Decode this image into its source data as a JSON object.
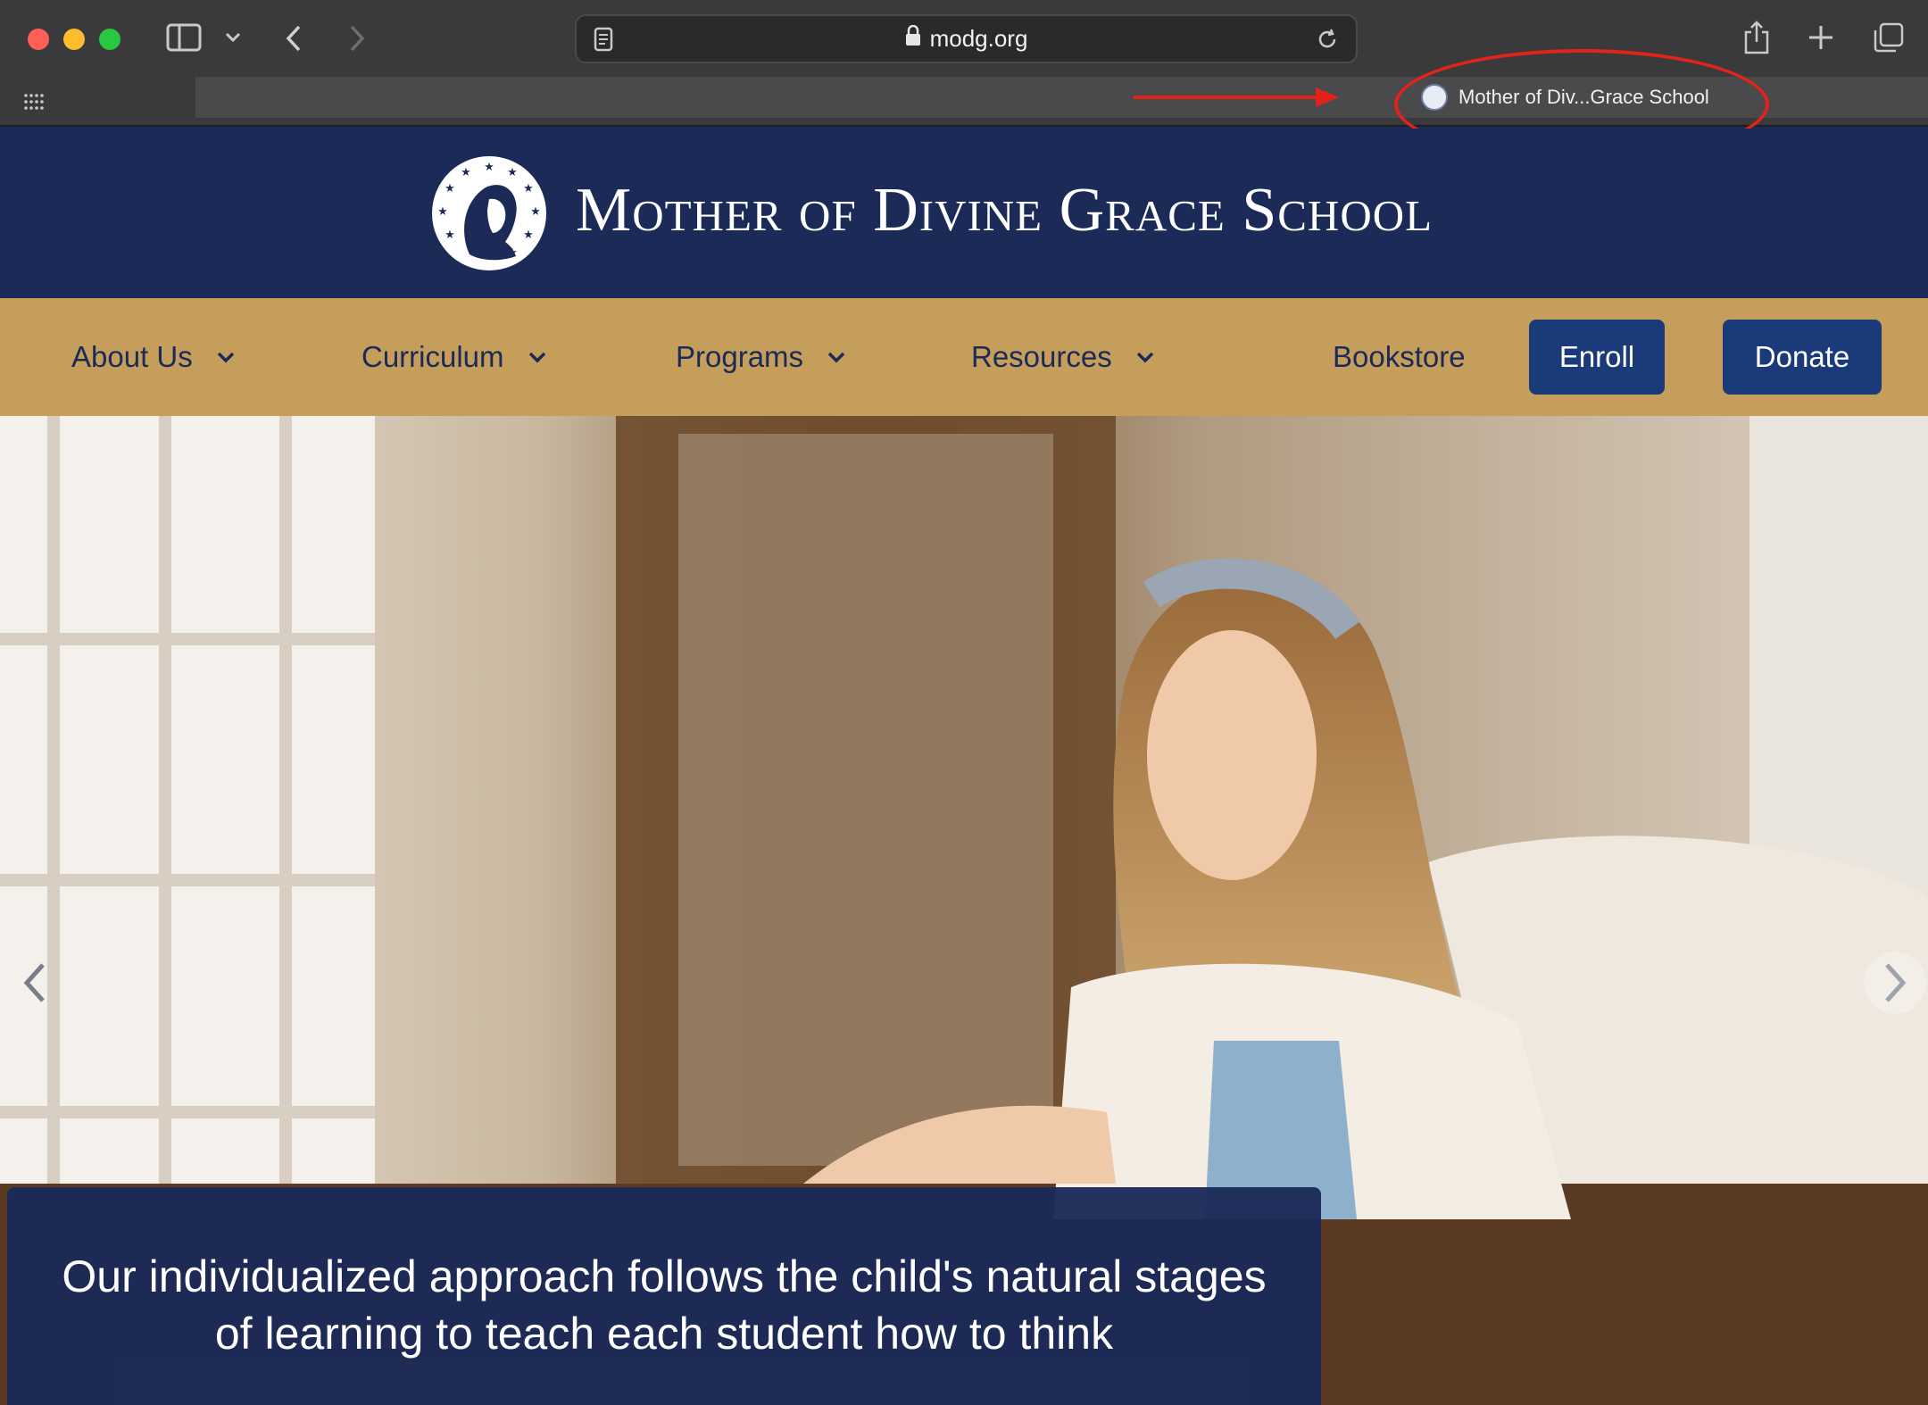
{
  "browser": {
    "url": "modg.org",
    "tab_title": "Mother of Div...Grace School"
  },
  "site": {
    "title": "Mother of Divine Grace School"
  },
  "nav": {
    "items": [
      {
        "label": "About Us"
      },
      {
        "label": "Curriculum"
      },
      {
        "label": "Programs"
      },
      {
        "label": "Resources"
      },
      {
        "label": "Bookstore"
      }
    ],
    "enroll_label": "Enroll",
    "donate_label": "Donate"
  },
  "hero": {
    "caption": "Our individualized approach follows the child's natural stages of learning to teach each student how to think"
  },
  "colors": {
    "header_navy": "#1b2a57",
    "nav_gold": "#c49e5a",
    "button_blue": "#1b3a7a",
    "annotation_red": "#e2231a"
  }
}
